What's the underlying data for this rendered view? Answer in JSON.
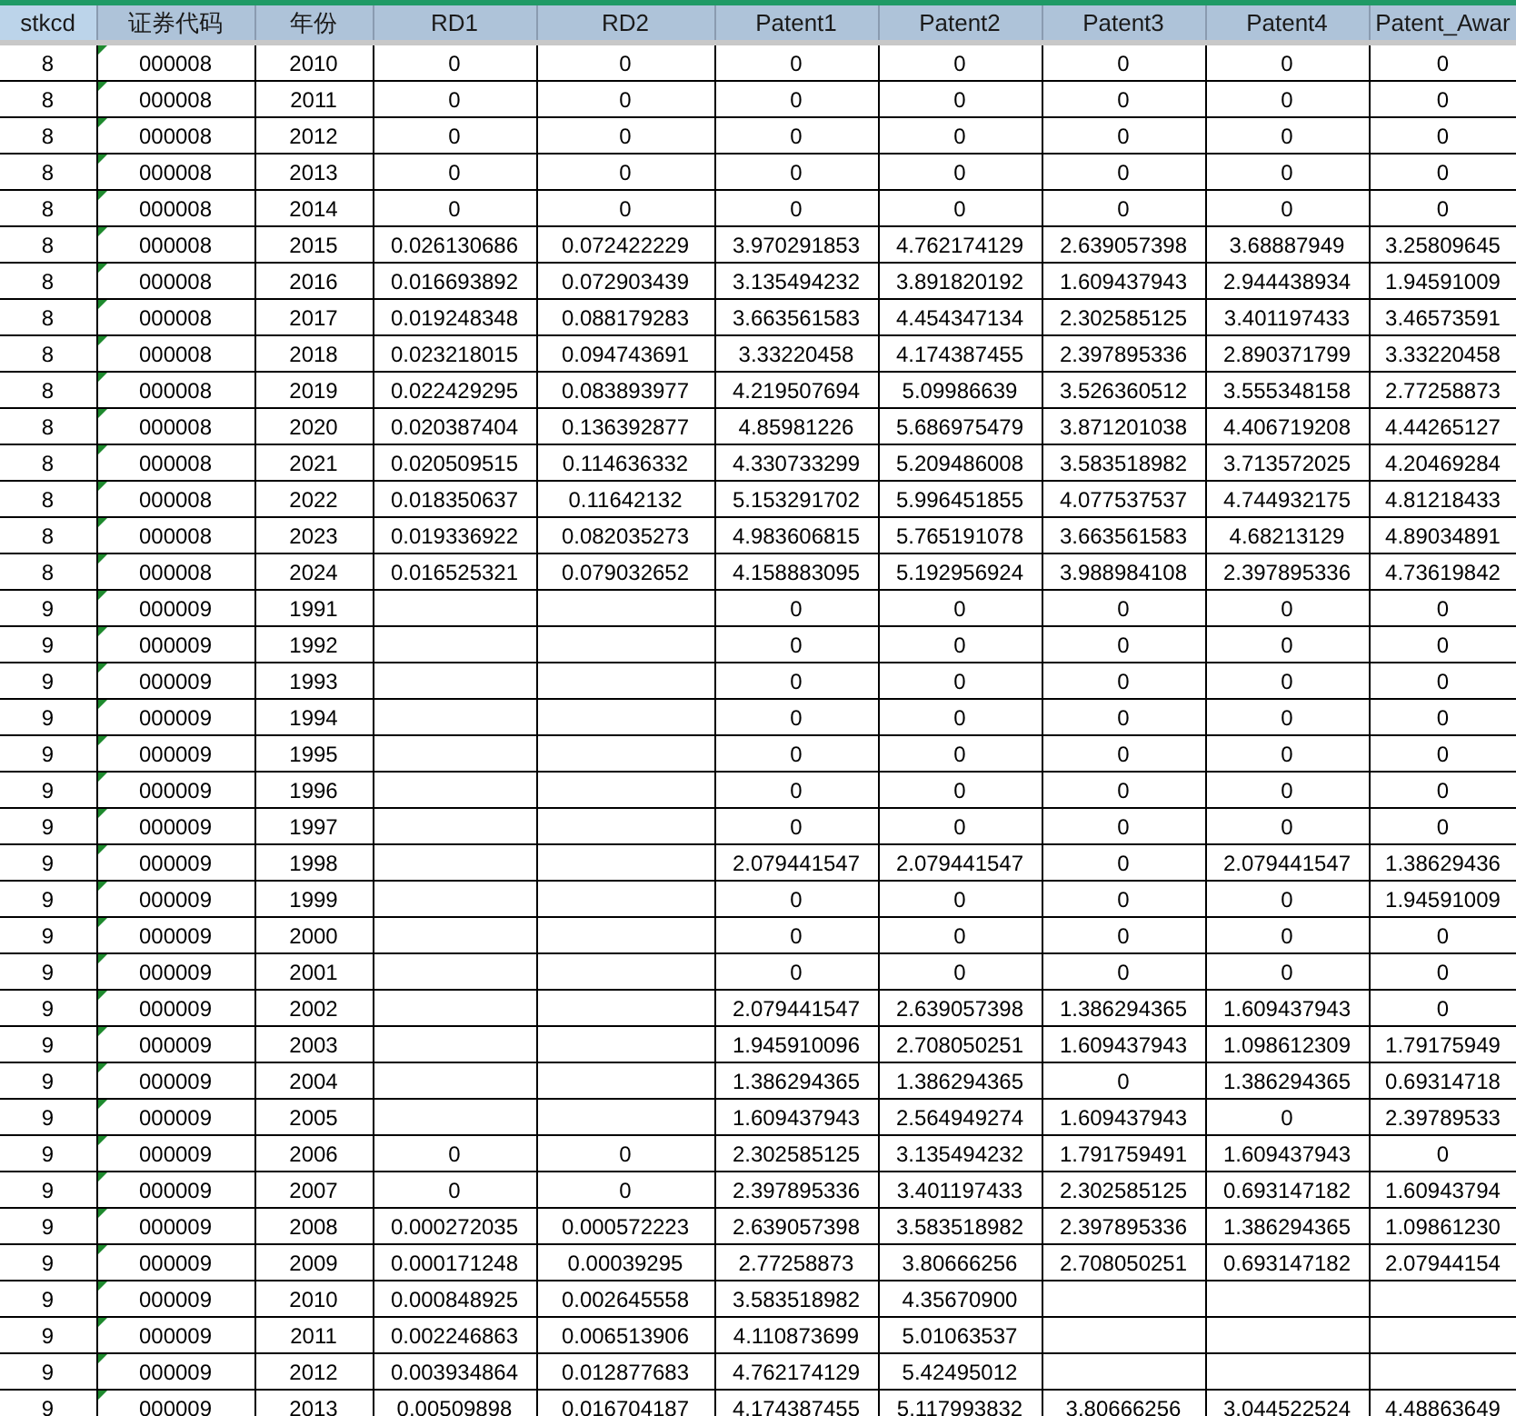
{
  "table": {
    "columns": [
      "stkcd",
      "证券代码",
      "年份",
      "RD1",
      "RD2",
      "Patent1",
      "Patent2",
      "Patent3",
      "Patent4",
      "Patent_Awar"
    ],
    "rows": [
      [
        "8",
        "000008",
        "2010",
        "0",
        "0",
        "0",
        "0",
        "0",
        "0",
        "0"
      ],
      [
        "8",
        "000008",
        "2011",
        "0",
        "0",
        "0",
        "0",
        "0",
        "0",
        "0"
      ],
      [
        "8",
        "000008",
        "2012",
        "0",
        "0",
        "0",
        "0",
        "0",
        "0",
        "0"
      ],
      [
        "8",
        "000008",
        "2013",
        "0",
        "0",
        "0",
        "0",
        "0",
        "0",
        "0"
      ],
      [
        "8",
        "000008",
        "2014",
        "0",
        "0",
        "0",
        "0",
        "0",
        "0",
        "0"
      ],
      [
        "8",
        "000008",
        "2015",
        "0.026130686",
        "0.072422229",
        "3.970291853",
        "4.762174129",
        "2.639057398",
        "3.68887949",
        "3.25809645"
      ],
      [
        "8",
        "000008",
        "2016",
        "0.016693892",
        "0.072903439",
        "3.135494232",
        "3.891820192",
        "1.609437943",
        "2.944438934",
        "1.94591009"
      ],
      [
        "8",
        "000008",
        "2017",
        "0.019248348",
        "0.088179283",
        "3.663561583",
        "4.454347134",
        "2.302585125",
        "3.401197433",
        "3.46573591"
      ],
      [
        "8",
        "000008",
        "2018",
        "0.023218015",
        "0.094743691",
        "3.33220458",
        "4.174387455",
        "2.397895336",
        "2.890371799",
        "3.33220458"
      ],
      [
        "8",
        "000008",
        "2019",
        "0.022429295",
        "0.083893977",
        "4.219507694",
        "5.09986639",
        "3.526360512",
        "3.555348158",
        "2.77258873"
      ],
      [
        "8",
        "000008",
        "2020",
        "0.020387404",
        "0.136392877",
        "4.85981226",
        "5.686975479",
        "3.871201038",
        "4.406719208",
        "4.44265127"
      ],
      [
        "8",
        "000008",
        "2021",
        "0.020509515",
        "0.114636332",
        "4.330733299",
        "5.209486008",
        "3.583518982",
        "3.713572025",
        "4.20469284"
      ],
      [
        "8",
        "000008",
        "2022",
        "0.018350637",
        "0.11642132",
        "5.153291702",
        "5.996451855",
        "4.077537537",
        "4.744932175",
        "4.81218433"
      ],
      [
        "8",
        "000008",
        "2023",
        "0.019336922",
        "0.082035273",
        "4.983606815",
        "5.765191078",
        "3.663561583",
        "4.68213129",
        "4.89034891"
      ],
      [
        "8",
        "000008",
        "2024",
        "0.016525321",
        "0.079032652",
        "4.158883095",
        "5.192956924",
        "3.988984108",
        "2.397895336",
        "4.73619842"
      ],
      [
        "9",
        "000009",
        "1991",
        null,
        null,
        "0",
        "0",
        "0",
        "0",
        "0"
      ],
      [
        "9",
        "000009",
        "1992",
        null,
        null,
        "0",
        "0",
        "0",
        "0",
        "0"
      ],
      [
        "9",
        "000009",
        "1993",
        null,
        null,
        "0",
        "0",
        "0",
        "0",
        "0"
      ],
      [
        "9",
        "000009",
        "1994",
        null,
        null,
        "0",
        "0",
        "0",
        "0",
        "0"
      ],
      [
        "9",
        "000009",
        "1995",
        null,
        null,
        "0",
        "0",
        "0",
        "0",
        "0"
      ],
      [
        "9",
        "000009",
        "1996",
        null,
        null,
        "0",
        "0",
        "0",
        "0",
        "0"
      ],
      [
        "9",
        "000009",
        "1997",
        null,
        null,
        "0",
        "0",
        "0",
        "0",
        "0"
      ],
      [
        "9",
        "000009",
        "1998",
        null,
        null,
        "2.079441547",
        "2.079441547",
        "0",
        "2.079441547",
        "1.38629436"
      ],
      [
        "9",
        "000009",
        "1999",
        null,
        null,
        "0",
        "0",
        "0",
        "0",
        "1.94591009"
      ],
      [
        "9",
        "000009",
        "2000",
        null,
        null,
        "0",
        "0",
        "0",
        "0",
        "0"
      ],
      [
        "9",
        "000009",
        "2001",
        null,
        null,
        "0",
        "0",
        "0",
        "0",
        "0"
      ],
      [
        "9",
        "000009",
        "2002",
        null,
        null,
        "2.079441547",
        "2.639057398",
        "1.386294365",
        "1.609437943",
        "0"
      ],
      [
        "9",
        "000009",
        "2003",
        null,
        null,
        "1.945910096",
        "2.708050251",
        "1.609437943",
        "1.098612309",
        "1.79175949"
      ],
      [
        "9",
        "000009",
        "2004",
        null,
        null,
        "1.386294365",
        "1.386294365",
        "0",
        "1.386294365",
        "0.69314718"
      ],
      [
        "9",
        "000009",
        "2005",
        null,
        null,
        "1.609437943",
        "2.564949274",
        "1.609437943",
        "0",
        "2.39789533"
      ],
      [
        "9",
        "000009",
        "2006",
        "0",
        "0",
        "2.302585125",
        "3.135494232",
        "1.791759491",
        "1.609437943",
        "0"
      ],
      [
        "9",
        "000009",
        "2007",
        "0",
        "0",
        "2.397895336",
        "3.401197433",
        "2.302585125",
        "0.693147182",
        "1.60943794"
      ],
      [
        "9",
        "000009",
        "2008",
        "0.000272035",
        "0.000572223",
        "2.639057398",
        "3.583518982",
        "2.397895336",
        "1.386294365",
        "1.09861230"
      ],
      [
        "9",
        "000009",
        "2009",
        "0.000171248",
        "0.00039295",
        "2.77258873",
        "3.80666256",
        "2.708050251",
        "0.693147182",
        "2.07944154"
      ],
      [
        "9",
        "000009",
        "2010",
        "0.000848925",
        "0.002645558",
        "3.583518982",
        "4.35670900",
        null,
        null,
        null
      ],
      [
        "9",
        "000009",
        "2011",
        "0.002246863",
        "0.006513906",
        "4.110873699",
        "5.01063537",
        null,
        null,
        null
      ],
      [
        "9",
        "000009",
        "2012",
        "0.003934864",
        "0.012877683",
        "4.762174129",
        "5.42495012",
        null,
        null,
        null
      ],
      [
        "9",
        "000009",
        "2013",
        "0.00509898",
        "0.016704187",
        "4.174387455",
        "5.117993832",
        "3.80666256",
        "3.044522524",
        "4.48863649"
      ]
    ]
  }
}
